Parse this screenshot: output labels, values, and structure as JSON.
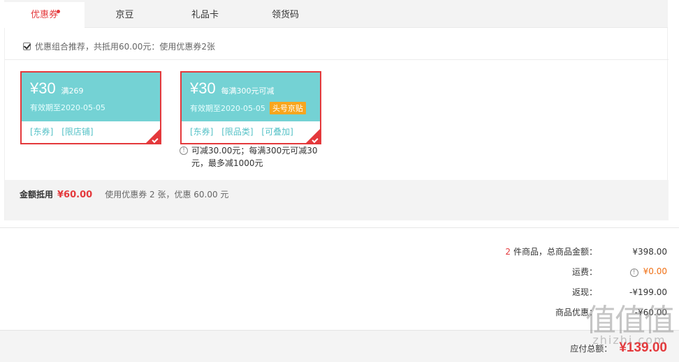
{
  "tabs": [
    {
      "label": "优惠券",
      "active": true
    },
    {
      "label": "京豆",
      "active": false
    },
    {
      "label": "礼品卡",
      "active": false
    },
    {
      "label": "领货码",
      "active": false
    }
  ],
  "recommend": {
    "checked": true,
    "text": "优惠组合推荐，共抵用60.00元：使用优惠券2张"
  },
  "coupons": [
    {
      "amount": "¥30",
      "condition": "满269",
      "valid": "有效期至2020-05-05",
      "tag": "",
      "labels": [
        "[东券]",
        "[限店铺]"
      ],
      "selected": true
    },
    {
      "amount": "¥30",
      "condition": "每满300元可减",
      "valid": "有效期至2020-05-05",
      "tag": "头号京贴",
      "labels": [
        "[东券]",
        "[限品类]",
        "[可叠加]"
      ],
      "selected": true
    }
  ],
  "coupon_note": "可减30.00元；每满300元可减30元，最多减1000元",
  "summary": {
    "label": "金额抵用",
    "value": "¥60.00",
    "desc": "使用优惠券 2 张，优惠 60.00 元"
  },
  "totals": {
    "items_count": "2",
    "items_label": "件商品，总商品金额：",
    "items_value": "¥398.00",
    "shipping_label": "运费：",
    "shipping_value": "¥0.00",
    "cashback_label": "返现：",
    "cashback_value": "-¥199.00",
    "discount_label": "商品优惠：",
    "discount_value": "-¥60.00"
  },
  "pay": {
    "label": "应付总额：",
    "value": "¥139.00"
  },
  "watermark": {
    "logo": "值值值",
    "site": "zhizhi.com"
  },
  "colors": {
    "accent": "#e4393c",
    "coupon_bg": "#74d2d4",
    "tag": "#f8a61e"
  }
}
